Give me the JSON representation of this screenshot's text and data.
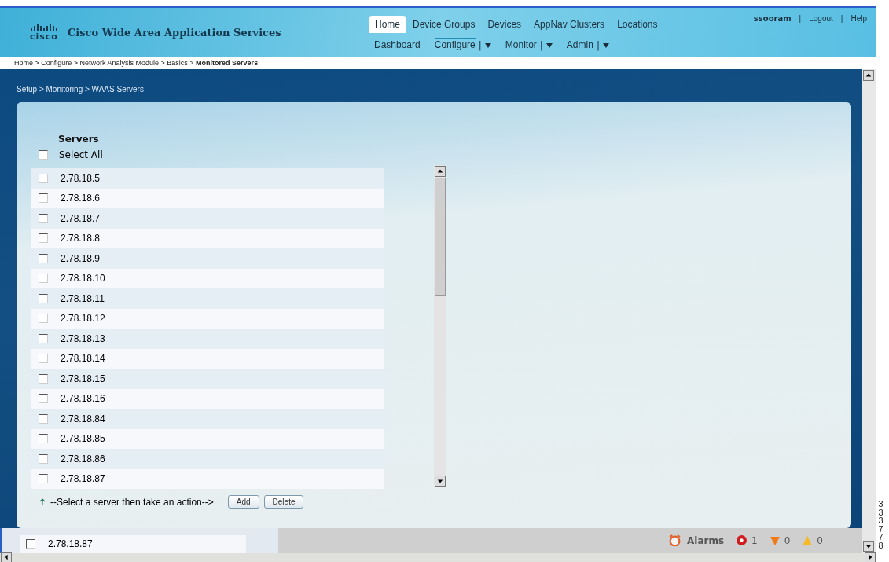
{
  "header": {
    "logo": "cisco",
    "title": "Cisco Wide Area Application Services",
    "user": "ssooram",
    "separator": "|",
    "links": [
      "Logout",
      "Help"
    ],
    "tabs": [
      {
        "label": "Home",
        "selected": true
      },
      {
        "label": "Device Groups",
        "selected": false
      },
      {
        "label": "Devices",
        "selected": false
      },
      {
        "label": "AppNav Clusters",
        "selected": false
      },
      {
        "label": "Locations",
        "selected": false
      }
    ],
    "menus": [
      {
        "label": "Dashboard",
        "dropdown": false,
        "selected": false
      },
      {
        "label": "Configure",
        "dropdown": true,
        "selected": true
      },
      {
        "label": "Monitor",
        "dropdown": true,
        "selected": false
      },
      {
        "label": "Admin",
        "dropdown": true,
        "selected": false
      }
    ]
  },
  "breadcrumb": "Home > Configure > Network Analysis Module > Basics > **Monitored Servers**",
  "subcrumb": "Setup > Monitoring > WAAS Servers",
  "panel": {
    "heading": "Servers",
    "select_all": {
      "label": "Select All",
      "checked": false
    },
    "servers": [
      {
        "address": "2.78.18.5",
        "checked": false
      },
      {
        "address": "2.78.18.6",
        "checked": false
      },
      {
        "address": "2.78.18.7",
        "checked": false
      },
      {
        "address": "2.78.18.8",
        "checked": false
      },
      {
        "address": "2.78.18.9",
        "checked": false
      },
      {
        "address": "2.78.18.10",
        "checked": false
      },
      {
        "address": "2.78.18.11",
        "checked": false
      },
      {
        "address": "2.78.18.12",
        "checked": false
      },
      {
        "address": "2.78.18.13",
        "checked": false
      },
      {
        "address": "2.78.18.14",
        "checked": false
      },
      {
        "address": "2.78.18.15",
        "checked": false
      },
      {
        "address": "2.78.18.16",
        "checked": false
      },
      {
        "address": "2.78.18.84",
        "checked": false
      },
      {
        "address": "2.78.18.85",
        "checked": false
      },
      {
        "address": "2.78.18.86",
        "checked": false
      },
      {
        "address": "2.78.18.87",
        "checked": false
      }
    ],
    "hint": "--Select a server then take an action-->",
    "buttons": [
      "Add",
      "Delete"
    ]
  },
  "behind_row": {
    "address": "2.78.18.87",
    "checked": false
  },
  "alarms": {
    "label": "Alarms",
    "counts": [
      {
        "kind": "critical",
        "count": "1"
      },
      {
        "kind": "major",
        "count": "0"
      },
      {
        "kind": "minor",
        "count": "0"
      }
    ]
  },
  "figure_id": "333778"
}
